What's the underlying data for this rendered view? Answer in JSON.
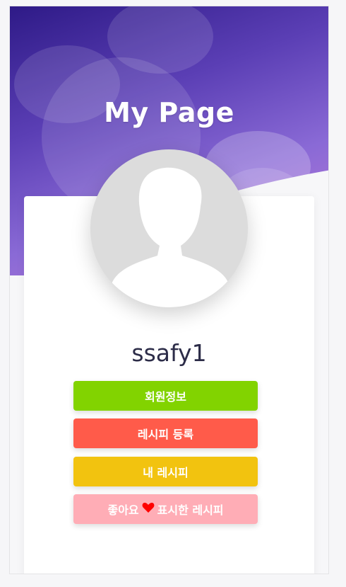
{
  "header": {
    "title": "My Page"
  },
  "profile": {
    "avatar_icon": "default-user-avatar-icon",
    "username": "ssafy1"
  },
  "actions": {
    "member_info": "회원정보",
    "register_recipe": "레시피 등록",
    "my_recipes": "내 레시피",
    "liked_before": "좋아요",
    "liked_after": "표시한 레시피",
    "heart_icon": "heart-icon"
  },
  "colors": {
    "member_info": "#82d300",
    "register_recipe": "#ff5b4a",
    "my_recipes": "#f2c30f",
    "liked_recipes": "#ffadb6",
    "heart": "#ff0000"
  }
}
